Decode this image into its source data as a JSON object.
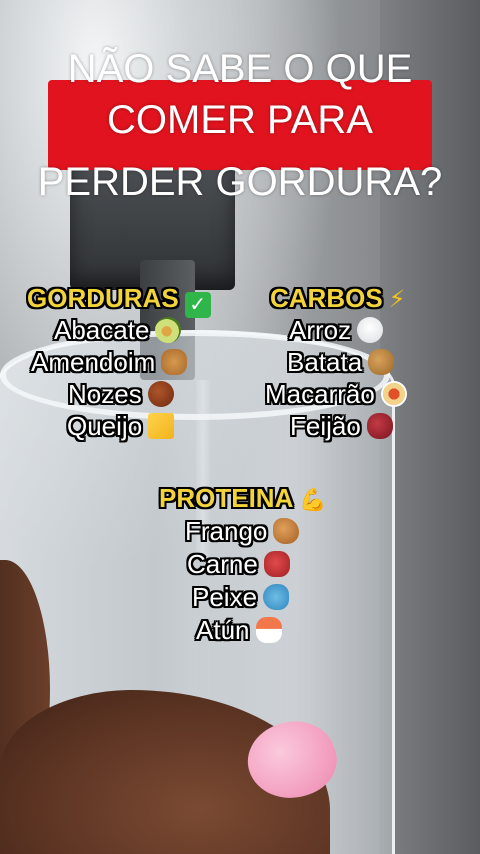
{
  "title": {
    "line1": "NÃO SABE O QUE",
    "line2": "COMER PARA",
    "line3": "PERDER GORDURA?"
  },
  "highlight_color": "#e1131e",
  "heading_color": "#f2d33a",
  "gorduras": {
    "heading": "GORDURAS",
    "heading_icon": "check-mark-icon",
    "items": [
      {
        "label": "Abacate",
        "icon": "avocado-icon"
      },
      {
        "label": "Amendoim",
        "icon": "peanuts-icon"
      },
      {
        "label": "Nozes",
        "icon": "chestnut-icon"
      },
      {
        "label": "Queijo",
        "icon": "cheese-icon"
      }
    ]
  },
  "carbos": {
    "heading": "CARBOS",
    "heading_icon": "lightning-icon",
    "items": [
      {
        "label": "Arroz",
        "icon": "rice-bowl-icon"
      },
      {
        "label": "Batata",
        "icon": "potato-icon"
      },
      {
        "label": "Macarrão",
        "icon": "spaghetti-icon"
      },
      {
        "label": "Feijão",
        "icon": "beans-icon"
      }
    ]
  },
  "proteina": {
    "heading": "PROTEINA",
    "heading_icon": "flexed-biceps-icon",
    "items": [
      {
        "label": "Frango",
        "icon": "poultry-leg-icon"
      },
      {
        "label": "Carne",
        "icon": "cut-of-meat-icon"
      },
      {
        "label": "Peixe",
        "icon": "fish-icon"
      },
      {
        "label": "Atún",
        "icon": "sushi-icon"
      }
    ]
  }
}
